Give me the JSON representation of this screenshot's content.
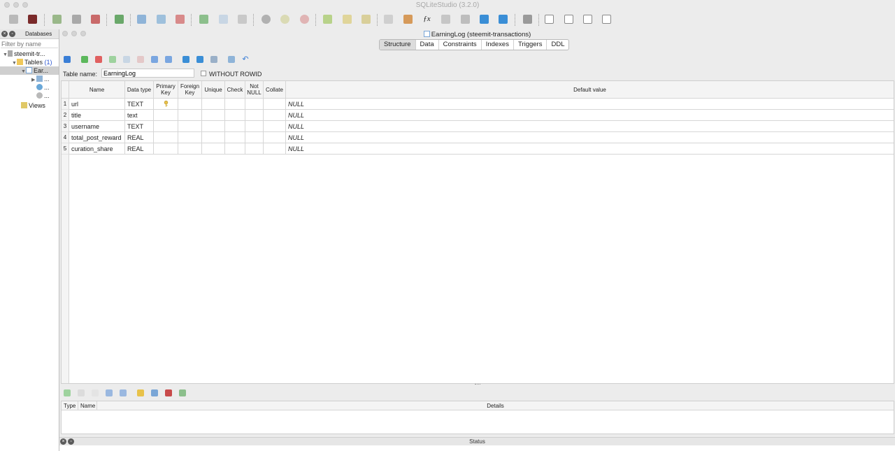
{
  "window": {
    "title": "SQLiteStudio (3.2.0)"
  },
  "databases_panel": {
    "title": "Databases",
    "filter_placeholder": "Filter by name",
    "tree": {
      "db": "steemit-tr...",
      "tables": "Tables",
      "tables_count": "(1)",
      "table": "Ear...",
      "child_1": "...",
      "child_2": "...",
      "child_3": "...",
      "views": "Views"
    }
  },
  "editor": {
    "title": "EarningLog (steemit-transactions)",
    "tabs": [
      "Structure",
      "Data",
      "Constraints",
      "Indexes",
      "Triggers",
      "DDL"
    ],
    "active_tab": "Structure",
    "table_name_label": "Table name:",
    "table_name_value": "EarningLog",
    "without_rowid_label": "WITHOUT ROWID",
    "columns": {
      "name": "Name",
      "data_type": "Data type",
      "primary_key_1": "Primary",
      "primary_key_2": "Key",
      "foreign_key_1": "Foreign",
      "foreign_key_2": "Key",
      "unique": "Unique",
      "check": "Check",
      "not_null_1": "Not",
      "not_null_2": "NULL",
      "collate": "Collate",
      "default_value": "Default value"
    },
    "rows": [
      {
        "num": "1",
        "name": "url",
        "type": "TEXT",
        "default": "NULL"
      },
      {
        "num": "2",
        "name": "title",
        "type": "text",
        "default": "NULL"
      },
      {
        "num": "3",
        "name": "username",
        "type": "TEXT",
        "default": "NULL"
      },
      {
        "num": "4",
        "name": "total_post_reward",
        "type": "REAL",
        "default": "NULL"
      },
      {
        "num": "5",
        "name": "curation_share",
        "type": "REAL",
        "default": "NULL"
      }
    ],
    "constraints_columns": {
      "type": "Type",
      "name": "Name",
      "details": "Details"
    }
  },
  "status": {
    "title": "Status"
  },
  "colors": {
    "key_icon": "#e8c24a",
    "window_bg": "#ececec"
  }
}
